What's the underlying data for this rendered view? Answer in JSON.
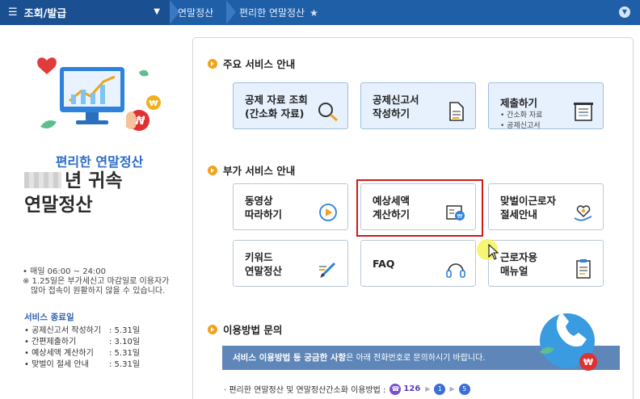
{
  "nav": {
    "menu_label": "조회/발급",
    "crumb1": "연말정산",
    "crumb2": "편리한 연말정산"
  },
  "left": {
    "hero_title": "편리한 연말정산",
    "title_line1": "년 귀속",
    "title_line2": "연말정산",
    "hours": "• 매일 06:00 ~ 24:00",
    "note1": "※ 1.25일은 부가세신고 마감일로 이용자가",
    "note2": "많아 접속이 원활하지 않을 수 있습니다.",
    "end_title": "서비스 종료일",
    "end_items": [
      {
        "name": "• 공제신고서 작성하기",
        "date": ": 5.31일"
      },
      {
        "name": "• 간편제출하기",
        "date": ": 3.10일"
      },
      {
        "name": "• 예상세액 계산하기",
        "date": ": 5.31일"
      },
      {
        "name": "• 맞벌이 절세 안내",
        "date": ": 5.31일"
      }
    ]
  },
  "sections": {
    "main": "주요 서비스 안내",
    "extra": "부가 서비스 안내",
    "contact": "이용방법 문의"
  },
  "main_cards": [
    {
      "label": "공제 자료 조회\n(간소화 자료)",
      "icon": "magnifier-icon"
    },
    {
      "label": "공제신고서\n작성하기",
      "icon": "document-icon"
    },
    {
      "title": "제출하기",
      "sub1": "• 간소화 자료",
      "sub2": "• 공제신고서",
      "icon": "printer-icon"
    }
  ],
  "extra_cards": [
    {
      "label": "동영상\n따라하기",
      "icon": "play-icon"
    },
    {
      "label": "예상세액\n계산하기",
      "icon": "calculator-icon"
    },
    {
      "label": "맞벌이근로자\n절세안내",
      "icon": "heart-hand-icon"
    },
    {
      "label": "키워드\n연말정산",
      "icon": "pencil-icon"
    },
    {
      "label": "FAQ",
      "icon": "headset-icon"
    },
    {
      "label": "근로자용\n매뉴얼",
      "icon": "manual-icon"
    }
  ],
  "banner": {
    "bold": "서비스 이용방법 등 궁금한 사항",
    "rest": "은 아래 전화번호로 문의하시기 바랍니다."
  },
  "footer": {
    "text": "· 편리한 연말정산 및 연말정산간소화 이용방법 :",
    "phone": "126",
    "step1": "1",
    "step2": "5"
  },
  "colors": {
    "nav": "#1f5fa8",
    "accent": "#f2a21b",
    "highlight": "#d11a1a"
  }
}
